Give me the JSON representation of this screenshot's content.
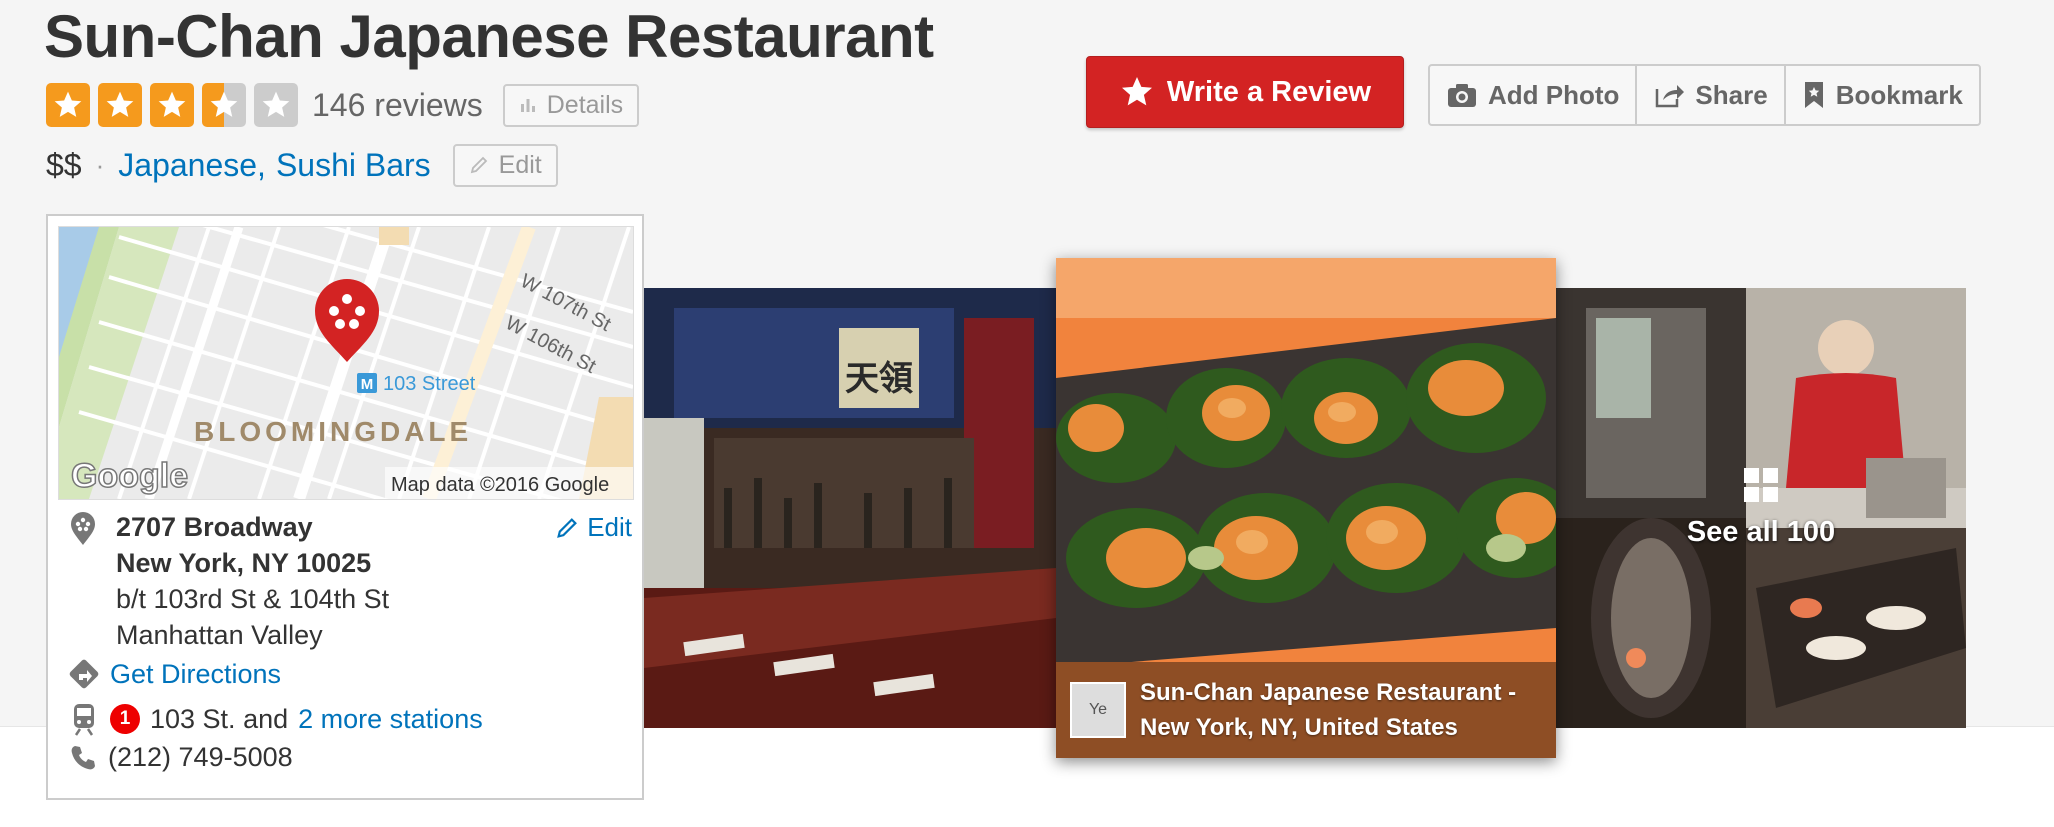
{
  "business": {
    "name": "Sun-Chan Japanese Restaurant",
    "rating": 3.5,
    "rating_max": 5,
    "review_count": "146 reviews",
    "details_label": "Details",
    "price": "$$",
    "separator": "·",
    "categories": [
      "Japanese",
      "Sushi Bars"
    ],
    "category_comma": ",",
    "edit_label": "Edit"
  },
  "actions": {
    "write_review": "Write a Review",
    "add_photo": "Add Photo",
    "share": "Share",
    "bookmark": "Bookmark"
  },
  "map": {
    "streets": [
      "W 107th St",
      "W 106th St"
    ],
    "station": "103 Street",
    "station_badge": "M",
    "neighborhood": "BLOOMINGDALE",
    "provider": "Google",
    "attribution": "Map data ©2016 Google"
  },
  "location": {
    "address_line1": "2707 Broadway",
    "address_line2": "New York, NY 10025",
    "cross_streets": "b/t 103rd St & 104th St",
    "neighborhood": "Manhattan Valley",
    "edit_label": "Edit",
    "directions_label": "Get Directions",
    "transit_line": "1",
    "transit_text": "103 St. and",
    "transit_more": "2 more stations",
    "phone": "(212) 749-5008"
  },
  "photos": {
    "caption_line1": "Sun-Chan Japanese Restaurant -",
    "caption_line2": "New York, NY, United States",
    "caption_thumb_alt": "Ye",
    "sign_text": "天領",
    "see_all": "See all 100"
  },
  "colors": {
    "brand_red": "#d32323",
    "star_filled": "#f59a1d",
    "star_empty": "#cccccc",
    "link": "#0073bb",
    "transit_line": "#ee0000"
  }
}
